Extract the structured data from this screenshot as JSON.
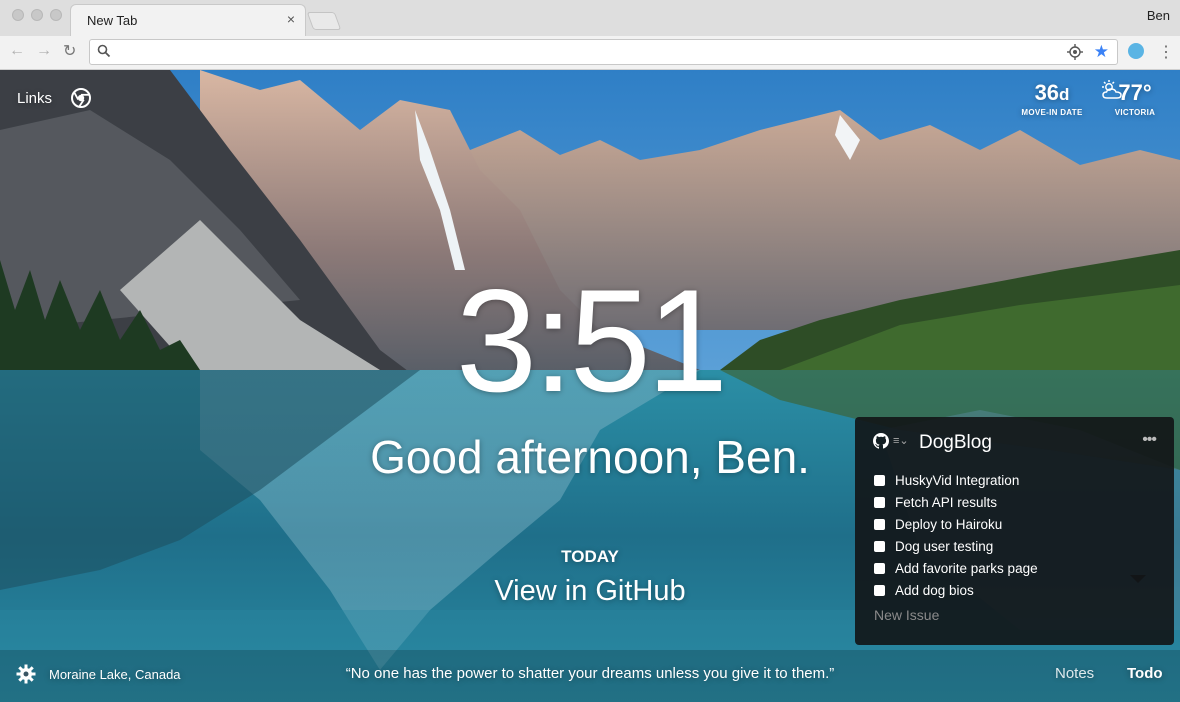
{
  "browser": {
    "tab_title": "New Tab",
    "tab_close": "×",
    "profile_name": "Ben",
    "nav": {
      "back": "←",
      "forward": "→",
      "reload": "↻"
    },
    "menu": "⋮"
  },
  "dashboard": {
    "links_label": "Links",
    "countdown": {
      "value": "36",
      "unit": "d",
      "label": "MOVE-IN DATE"
    },
    "weather": {
      "temp": "77°",
      "label": "VICTORIA"
    },
    "clock": "3:51",
    "greeting": "Good afternoon, Ben.",
    "today": {
      "label": "TODAY",
      "link": "View in GitHub"
    },
    "location": "Moraine Lake, Canada",
    "quote": "“No one has the power to shatter your dreams unless you give it to them.”",
    "footer_links": {
      "notes": "Notes",
      "todo": "Todo"
    }
  },
  "todo": {
    "project": "DogBlog",
    "more": "•••",
    "list_icon": "≡⌄",
    "tasks": [
      "HuskyVid Integration",
      "Fetch API results",
      "Deploy to Hairoku",
      "Dog user testing",
      "Add favorite parks page",
      "Add dog bios"
    ],
    "new_issue_placeholder": "New Issue"
  },
  "colors": {
    "star": "#3b82f6",
    "panel_bg": "#121416",
    "text": "#ffffff"
  },
  "icons": [
    "search-icon",
    "location-target-icon",
    "star-icon",
    "chrome-icon",
    "weather-cloud-sun-icon",
    "github-icon",
    "list-icon",
    "more-icon",
    "settings-gear-icon"
  ]
}
